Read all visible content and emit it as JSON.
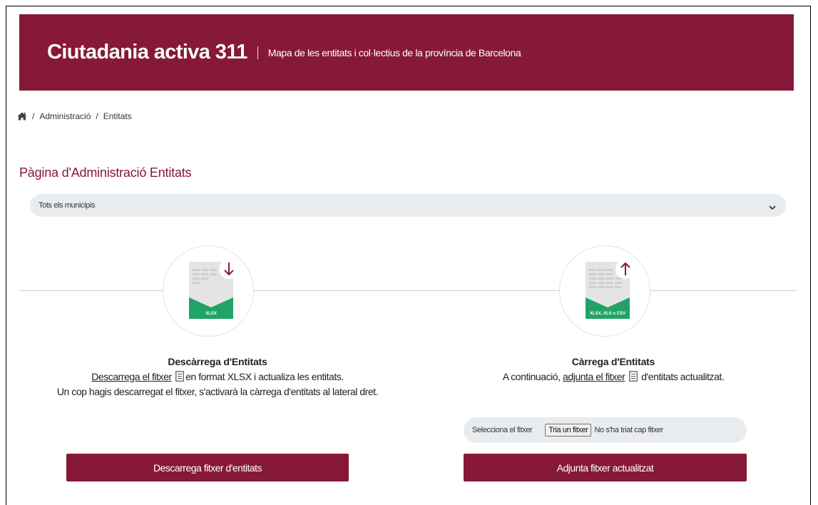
{
  "header": {
    "title": "Ciutadania activa 311",
    "subtitle": "Mapa de les entitats i col·lectius de la província de Barcelona"
  },
  "breadcrumb": {
    "items": [
      "Administració",
      "Entitats"
    ],
    "separator": "/"
  },
  "page_title": "Pàgina d'Administració Entitats",
  "municipality_select": {
    "selected": "Tots els municipis"
  },
  "download": {
    "badge": "XLSX",
    "heading": "Descàrrega d'Entitats",
    "link_text": "Descarrega el fitxer",
    "after_link": "en format XLSX i actualiza les entitats.",
    "note": "Un cop hagis descarregat el fitxer, s'activarà la càrrega d'entitats al lateral dret.",
    "button": "Descarrega fitxer d'entitats"
  },
  "upload": {
    "badge": "XLSX, XLS o CSV",
    "heading": "Càrrega d'Entitats",
    "before_link": "A continuació,",
    "link_text": "adjunta el fitxer",
    "after_link": "d'entitats actualitzat.",
    "file_label": "Selecciona el fitxer",
    "file_button": "Tria un fitxer",
    "file_status": "No s'ha triat cap fitxer",
    "button": "Adjunta fitxer actualitzat"
  },
  "colors": {
    "brand": "#861838",
    "excel_green": "#21a366",
    "input_bg": "#e9ecef"
  },
  "icons": {
    "home": "home-icon",
    "select": "chevron-down-icon",
    "download": "download-arrow-icon",
    "upload": "upload-arrow-icon",
    "document": "document-icon"
  }
}
